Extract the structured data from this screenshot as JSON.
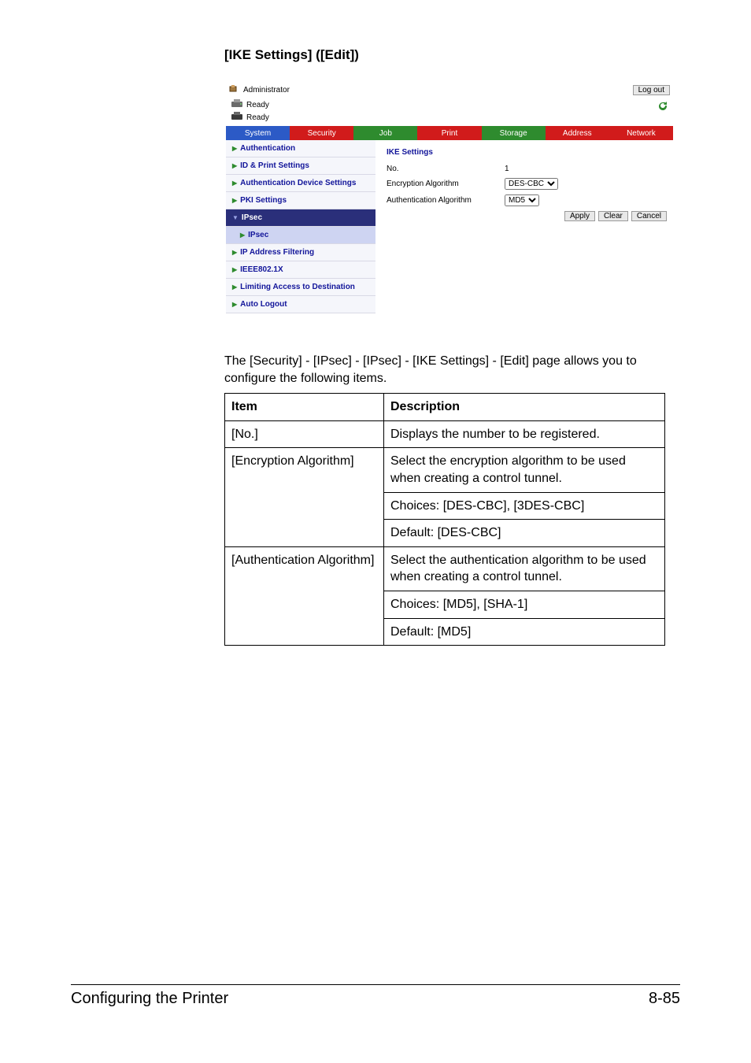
{
  "title": "[IKE Settings] ([Edit])",
  "shot": {
    "adminLabel": "Administrator",
    "logout": "Log out",
    "ready1": "Ready",
    "ready2": "Ready",
    "tabs": [
      "System",
      "Security",
      "Job",
      "Print",
      "Storage",
      "Address",
      "Network"
    ],
    "side": {
      "items": [
        {
          "label": "Authentication",
          "sel": false,
          "dark": false
        },
        {
          "label": "ID & Print Settings",
          "sel": false,
          "dark": false
        },
        {
          "label": "Authentication Device Settings",
          "sel": false,
          "dark": false
        },
        {
          "label": "PKI Settings",
          "sel": false,
          "dark": false
        },
        {
          "label": "IPsec",
          "sel": false,
          "dark": true
        },
        {
          "label": "IPsec",
          "sel": true,
          "dark": false
        },
        {
          "label": "IP Address Filtering",
          "sel": false,
          "dark": false
        },
        {
          "label": "IEEE802.1X",
          "sel": false,
          "dark": false
        },
        {
          "label": "Limiting Access to Destination",
          "sel": false,
          "dark": false
        },
        {
          "label": "Auto Logout",
          "sel": false,
          "dark": false
        }
      ]
    },
    "main": {
      "section": "IKE Settings",
      "noLabel": "No.",
      "noVal": "1",
      "encLabel": "Encryption Algorithm",
      "encOptions": [
        "DES-CBC"
      ],
      "authLabel": "Authentication Algorithm",
      "authOptions": [
        "MD5"
      ],
      "btnApply": "Apply",
      "btnClear": "Clear",
      "btnCancel": "Cancel"
    }
  },
  "intro": "The [Security] - [IPsec] - [IPsec] - [IKE Settings] - [Edit] page allows you to configure the following items.",
  "table": {
    "hItem": "Item",
    "hDesc": "Description",
    "rows": [
      {
        "item": "[No.]",
        "desc": [
          "Displays the number to be registered."
        ]
      },
      {
        "item": "[Encryption Algorithm]",
        "desc": [
          "Select the encryption algorithm to be used when creating a control tunnel.",
          "Choices: [DES-CBC], [3DES-CBC]",
          "Default: [DES-CBC]"
        ]
      },
      {
        "item": "[Authentication Algorithm]",
        "desc": [
          "Select the authentication algorithm to be used when creating a control tunnel.",
          "Choices: [MD5], [SHA-1]",
          "Default: [MD5]"
        ]
      }
    ]
  },
  "footer": {
    "left": "Configuring the Printer",
    "right": "8-85"
  }
}
